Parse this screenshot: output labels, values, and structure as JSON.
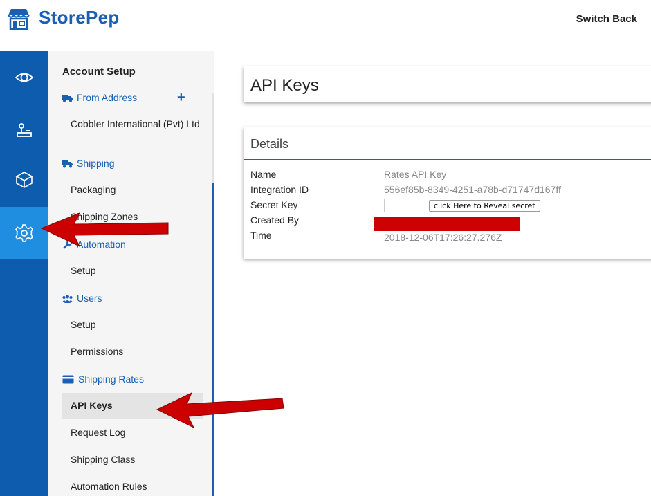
{
  "header": {
    "brand": "StorePep",
    "switch_back": "Switch Back"
  },
  "rail": {
    "items": [
      {
        "icon": "eye-icon"
      },
      {
        "icon": "joystick-icon"
      },
      {
        "icon": "box-icon"
      },
      {
        "icon": "gear-icon",
        "active": true
      }
    ]
  },
  "subnav": {
    "title": "Account Setup",
    "sections": [
      {
        "label": "From Address",
        "icon": "truck-icon",
        "items": [
          "Cobbler International (Pvt) Ltd"
        ]
      },
      {
        "label": "Shipping",
        "icon": "truck-icon",
        "items": [
          "Packaging",
          "Shipping Zones"
        ]
      },
      {
        "label": "Automation",
        "icon": "wrench-icon",
        "items": [
          "Setup"
        ]
      },
      {
        "label": "Users",
        "icon": "users-icon",
        "items": [
          "Setup",
          "Permissions"
        ]
      },
      {
        "label": "Shipping Rates",
        "icon": "credit-card-icon",
        "items": [
          "API Keys",
          "Request Log",
          "Shipping Class",
          "Automation Rules"
        ]
      }
    ],
    "plus": "+",
    "selected": "API Keys"
  },
  "main": {
    "page_title": "API Keys",
    "details": {
      "heading": "Details",
      "rows": [
        {
          "label": "Name",
          "value": "Rates API Key"
        },
        {
          "label": "Integration ID",
          "value": "556ef85b-8349-4251-a78b-d71747d167ff"
        },
        {
          "label": "Secret Key",
          "value": ""
        },
        {
          "label": "Created By",
          "value": ""
        },
        {
          "label": "Time",
          "value": "2018-12-06T17:26:27.276Z"
        }
      ],
      "reveal_button": "click Here to Reveal secret"
    }
  },
  "colors": {
    "brand_blue": "#1b5fb0",
    "rail_blue": "#0d5cad",
    "rail_active": "#1f8ee0",
    "redaction": "#cc0000",
    "arrow_red": "#cc0000"
  }
}
